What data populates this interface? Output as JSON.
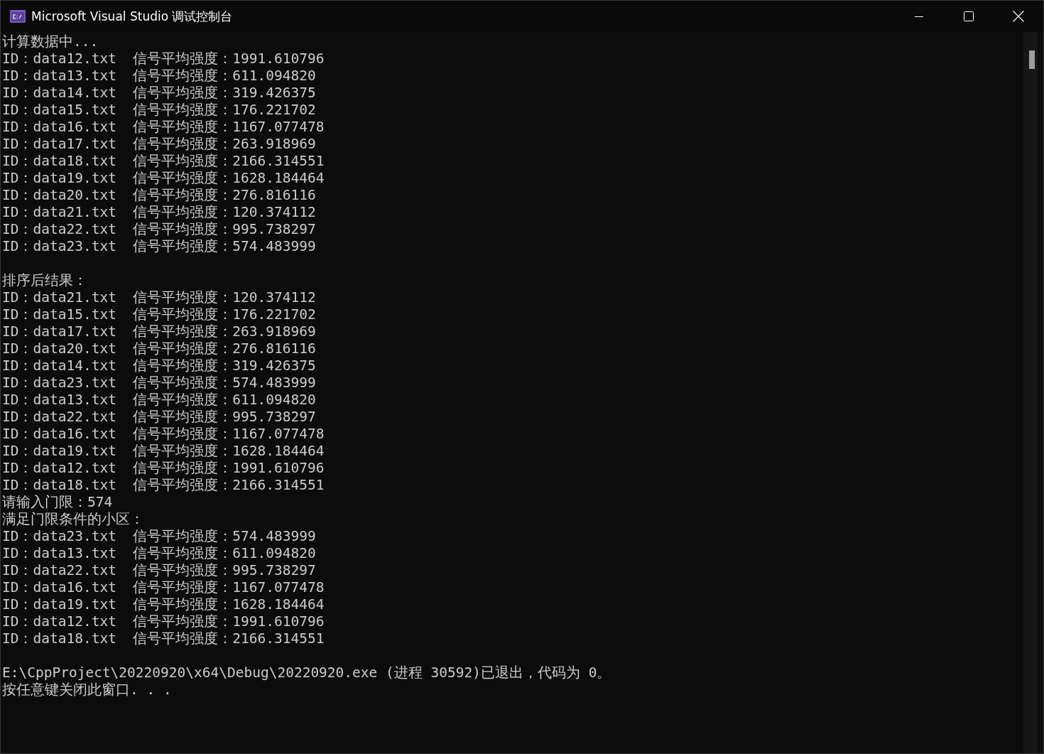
{
  "window": {
    "title": "Microsoft Visual Studio 调试控制台"
  },
  "console": {
    "sections": [
      {
        "lines": [
          "计算数据中...",
          "ID：data12.txt  信号平均强度：1991.610796",
          "ID：data13.txt  信号平均强度：611.094820",
          "ID：data14.txt  信号平均强度：319.426375",
          "ID：data15.txt  信号平均强度：176.221702",
          "ID：data16.txt  信号平均强度：1167.077478",
          "ID：data17.txt  信号平均强度：263.918969",
          "ID：data18.txt  信号平均强度：2166.314551",
          "ID：data19.txt  信号平均强度：1628.184464",
          "ID：data20.txt  信号平均强度：276.816116",
          "ID：data21.txt  信号平均强度：120.374112",
          "ID：data22.txt  信号平均强度：995.738297",
          "ID：data23.txt  信号平均强度：574.483999"
        ]
      },
      {
        "lines": [
          "排序后结果：",
          "ID：data21.txt  信号平均强度：120.374112",
          "ID：data15.txt  信号平均强度：176.221702",
          "ID：data17.txt  信号平均强度：263.918969",
          "ID：data20.txt  信号平均强度：276.816116",
          "ID：data14.txt  信号平均强度：319.426375",
          "ID：data23.txt  信号平均强度：574.483999",
          "ID：data13.txt  信号平均强度：611.094820",
          "ID：data22.txt  信号平均强度：995.738297",
          "ID：data16.txt  信号平均强度：1167.077478",
          "ID：data19.txt  信号平均强度：1628.184464",
          "ID：data12.txt  信号平均强度：1991.610796",
          "ID：data18.txt  信号平均强度：2166.314551",
          "请输入门限：574",
          "满足门限条件的小区：",
          "ID：data23.txt  信号平均强度：574.483999",
          "ID：data13.txt  信号平均强度：611.094820",
          "ID：data22.txt  信号平均强度：995.738297",
          "ID：data16.txt  信号平均强度：1167.077478",
          "ID：data19.txt  信号平均强度：1628.184464",
          "ID：data12.txt  信号平均强度：1991.610796",
          "ID：data18.txt  信号平均强度：2166.314551"
        ]
      },
      {
        "lines": [
          "E:\\CppProject\\20220920\\x64\\Debug\\20220920.exe (进程 30592)已退出，代码为 0。",
          "按任意键关闭此窗口. . ."
        ]
      }
    ]
  }
}
